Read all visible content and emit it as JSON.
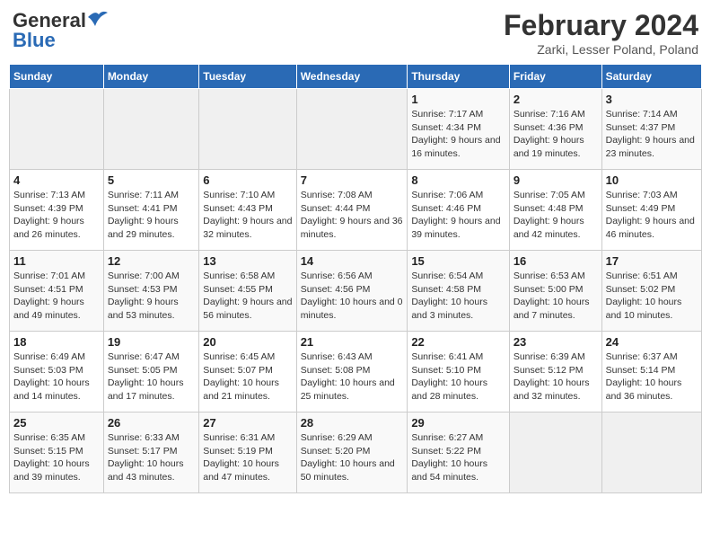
{
  "header": {
    "logo_general": "General",
    "logo_blue": "Blue",
    "month_title": "February 2024",
    "location": "Zarki, Lesser Poland, Poland"
  },
  "weekdays": [
    "Sunday",
    "Monday",
    "Tuesday",
    "Wednesday",
    "Thursday",
    "Friday",
    "Saturday"
  ],
  "weeks": [
    [
      {
        "day": "",
        "info": ""
      },
      {
        "day": "",
        "info": ""
      },
      {
        "day": "",
        "info": ""
      },
      {
        "day": "",
        "info": ""
      },
      {
        "day": "1",
        "info": "Sunrise: 7:17 AM\nSunset: 4:34 PM\nDaylight: 9 hours\nand 16 minutes."
      },
      {
        "day": "2",
        "info": "Sunrise: 7:16 AM\nSunset: 4:36 PM\nDaylight: 9 hours\nand 19 minutes."
      },
      {
        "day": "3",
        "info": "Sunrise: 7:14 AM\nSunset: 4:37 PM\nDaylight: 9 hours\nand 23 minutes."
      }
    ],
    [
      {
        "day": "4",
        "info": "Sunrise: 7:13 AM\nSunset: 4:39 PM\nDaylight: 9 hours\nand 26 minutes."
      },
      {
        "day": "5",
        "info": "Sunrise: 7:11 AM\nSunset: 4:41 PM\nDaylight: 9 hours\nand 29 minutes."
      },
      {
        "day": "6",
        "info": "Sunrise: 7:10 AM\nSunset: 4:43 PM\nDaylight: 9 hours\nand 32 minutes."
      },
      {
        "day": "7",
        "info": "Sunrise: 7:08 AM\nSunset: 4:44 PM\nDaylight: 9 hours\nand 36 minutes."
      },
      {
        "day": "8",
        "info": "Sunrise: 7:06 AM\nSunset: 4:46 PM\nDaylight: 9 hours\nand 39 minutes."
      },
      {
        "day": "9",
        "info": "Sunrise: 7:05 AM\nSunset: 4:48 PM\nDaylight: 9 hours\nand 42 minutes."
      },
      {
        "day": "10",
        "info": "Sunrise: 7:03 AM\nSunset: 4:49 PM\nDaylight: 9 hours\nand 46 minutes."
      }
    ],
    [
      {
        "day": "11",
        "info": "Sunrise: 7:01 AM\nSunset: 4:51 PM\nDaylight: 9 hours\nand 49 minutes."
      },
      {
        "day": "12",
        "info": "Sunrise: 7:00 AM\nSunset: 4:53 PM\nDaylight: 9 hours\nand 53 minutes."
      },
      {
        "day": "13",
        "info": "Sunrise: 6:58 AM\nSunset: 4:55 PM\nDaylight: 9 hours\nand 56 minutes."
      },
      {
        "day": "14",
        "info": "Sunrise: 6:56 AM\nSunset: 4:56 PM\nDaylight: 10 hours\nand 0 minutes."
      },
      {
        "day": "15",
        "info": "Sunrise: 6:54 AM\nSunset: 4:58 PM\nDaylight: 10 hours\nand 3 minutes."
      },
      {
        "day": "16",
        "info": "Sunrise: 6:53 AM\nSunset: 5:00 PM\nDaylight: 10 hours\nand 7 minutes."
      },
      {
        "day": "17",
        "info": "Sunrise: 6:51 AM\nSunset: 5:02 PM\nDaylight: 10 hours\nand 10 minutes."
      }
    ],
    [
      {
        "day": "18",
        "info": "Sunrise: 6:49 AM\nSunset: 5:03 PM\nDaylight: 10 hours\nand 14 minutes."
      },
      {
        "day": "19",
        "info": "Sunrise: 6:47 AM\nSunset: 5:05 PM\nDaylight: 10 hours\nand 17 minutes."
      },
      {
        "day": "20",
        "info": "Sunrise: 6:45 AM\nSunset: 5:07 PM\nDaylight: 10 hours\nand 21 minutes."
      },
      {
        "day": "21",
        "info": "Sunrise: 6:43 AM\nSunset: 5:08 PM\nDaylight: 10 hours\nand 25 minutes."
      },
      {
        "day": "22",
        "info": "Sunrise: 6:41 AM\nSunset: 5:10 PM\nDaylight: 10 hours\nand 28 minutes."
      },
      {
        "day": "23",
        "info": "Sunrise: 6:39 AM\nSunset: 5:12 PM\nDaylight: 10 hours\nand 32 minutes."
      },
      {
        "day": "24",
        "info": "Sunrise: 6:37 AM\nSunset: 5:14 PM\nDaylight: 10 hours\nand 36 minutes."
      }
    ],
    [
      {
        "day": "25",
        "info": "Sunrise: 6:35 AM\nSunset: 5:15 PM\nDaylight: 10 hours\nand 39 minutes."
      },
      {
        "day": "26",
        "info": "Sunrise: 6:33 AM\nSunset: 5:17 PM\nDaylight: 10 hours\nand 43 minutes."
      },
      {
        "day": "27",
        "info": "Sunrise: 6:31 AM\nSunset: 5:19 PM\nDaylight: 10 hours\nand 47 minutes."
      },
      {
        "day": "28",
        "info": "Sunrise: 6:29 AM\nSunset: 5:20 PM\nDaylight: 10 hours\nand 50 minutes."
      },
      {
        "day": "29",
        "info": "Sunrise: 6:27 AM\nSunset: 5:22 PM\nDaylight: 10 hours\nand 54 minutes."
      },
      {
        "day": "",
        "info": ""
      },
      {
        "day": "",
        "info": ""
      }
    ]
  ]
}
